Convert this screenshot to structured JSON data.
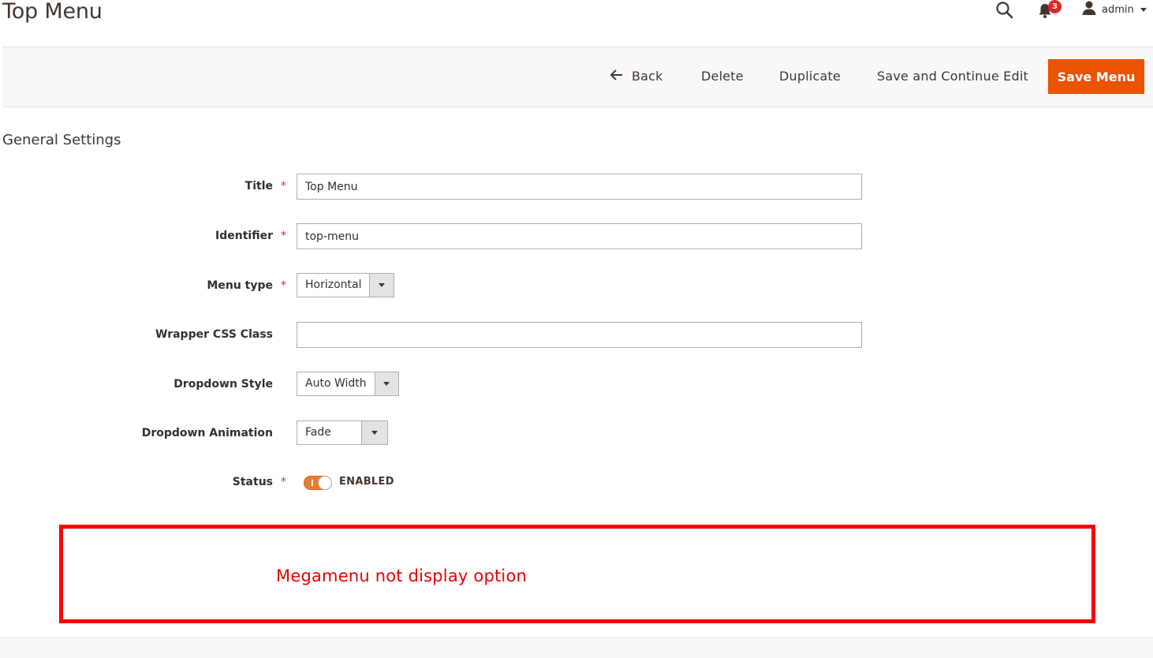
{
  "page": {
    "title": "Top Menu"
  },
  "header": {
    "notifications_count": "3",
    "user_label": "admin"
  },
  "toolbar": {
    "back_label": "Back",
    "delete_label": "Delete",
    "duplicate_label": "Duplicate",
    "save_continue_label": "Save and Continue Edit",
    "save_label": "Save Menu"
  },
  "form": {
    "section_title": "General Settings",
    "required_mark": "*",
    "fields": {
      "title": {
        "label": "Title",
        "value": "Top Menu"
      },
      "identifier": {
        "label": "Identifier",
        "value": "top-menu"
      },
      "menu_type": {
        "label": "Menu type",
        "value": "Horizontal"
      },
      "wrapper_css_class": {
        "label": "Wrapper CSS Class",
        "value": ""
      },
      "dropdown_style": {
        "label": "Dropdown Style",
        "value": "Auto Width"
      },
      "dropdown_animation": {
        "label": "Dropdown Animation",
        "value": "Fade"
      },
      "status": {
        "label": "Status",
        "value": "ENABLED",
        "on": true
      }
    }
  },
  "annotation": {
    "text": "Megamenu not display option",
    "color": "#f80000"
  },
  "colors": {
    "accent": "#eb5202",
    "toggle_on": "#eb7d32",
    "required": "#e22626"
  }
}
